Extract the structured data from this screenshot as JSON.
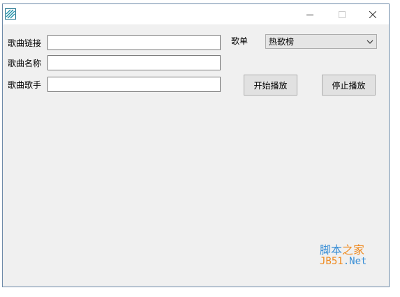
{
  "window": {
    "controls": {
      "minimize": "minimize-icon",
      "maximize": "maximize-icon",
      "close": "close-icon"
    }
  },
  "form": {
    "song_link_label": "歌曲链接",
    "song_link_value": "",
    "song_name_label": "歌曲名称",
    "song_name_value": "",
    "song_artist_label": "歌曲歌手",
    "song_artist_value": ""
  },
  "playlist": {
    "label": "歌单",
    "selected": "热歌榜"
  },
  "buttons": {
    "start_label": "开始播放",
    "stop_label": "停止播放"
  },
  "watermark": {
    "line1_a": "脚本",
    "line1_b": "之家",
    "line2_a": "JB51",
    "line2_b": ".Net"
  },
  "colors": {
    "window_bg": "#f0f0f0",
    "watermark_blue": "#3a8fd6",
    "watermark_orange": "#ef8a1f"
  }
}
